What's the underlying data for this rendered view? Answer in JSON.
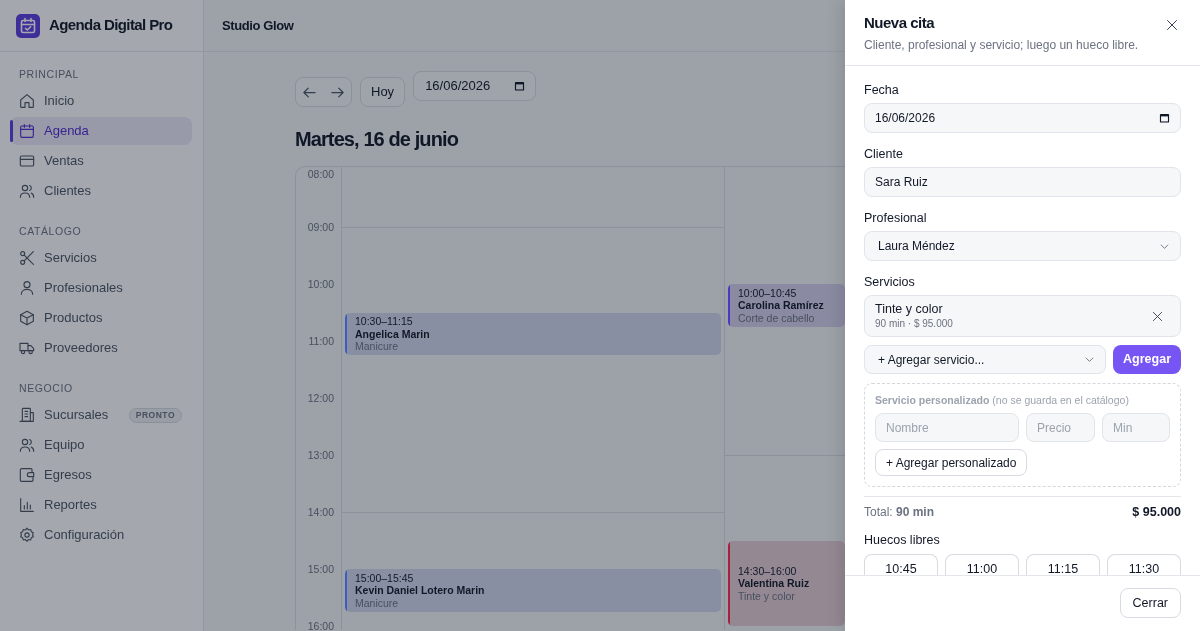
{
  "sidebar": {
    "brand": "Agenda Digital Pro",
    "sections": [
      {
        "heading": "PRINCIPAL",
        "items": [
          {
            "label": "Inicio",
            "selected": false
          },
          {
            "label": "Agenda",
            "selected": true
          },
          {
            "label": "Ventas",
            "selected": false
          },
          {
            "label": "Clientes",
            "selected": false
          }
        ]
      },
      {
        "heading": "CATÁLOGO",
        "items": [
          {
            "label": "Servicios",
            "selected": false
          },
          {
            "label": "Profesionales",
            "selected": false
          },
          {
            "label": "Productos",
            "selected": false
          },
          {
            "label": "Proveedores",
            "selected": false
          }
        ]
      },
      {
        "heading": "NEGOCIO",
        "items": [
          {
            "label": "Sucursales",
            "selected": false,
            "badge": "PRONTO"
          },
          {
            "label": "Equipo",
            "selected": false
          },
          {
            "label": "Egresos",
            "selected": false
          },
          {
            "label": "Reportes",
            "selected": false
          },
          {
            "label": "Configuración",
            "selected": false
          }
        ]
      }
    ]
  },
  "topbar": {
    "title": "Studio Glow"
  },
  "toolbar": {
    "today_button": "Hoy",
    "date": "16/06/2026"
  },
  "day_title": "Martes, 16 de junio",
  "calendar": {
    "hours": [
      "08:00",
      "09:00",
      "10:00",
      "11:00",
      "12:00",
      "13:00",
      "14:00",
      "15:00",
      "16:00"
    ],
    "columns": [
      {
        "appointments": [
          {
            "time": "10:30–11:15",
            "client": "Angelica Marin",
            "service": "Manicure",
            "color": "#3c5cc4"
          },
          {
            "time": "15:00–15:45",
            "client": "Kevin Daniel Lotero Marin",
            "service": "Manicure",
            "color": "#3c5cc4"
          }
        ]
      },
      {
        "appointments": [
          {
            "time": "10:00–10:45",
            "client": "Carolina Ramírez",
            "service": "Corte de cabello",
            "color": "#4e38c0"
          },
          {
            "time": "14:30–16:00",
            "client": "Valentina Ruiz",
            "service": "Tinte y color",
            "color": "#a8203f"
          }
        ]
      }
    ]
  },
  "panel": {
    "title": "Nueva cita",
    "subtitle": "Cliente, profesional y servicio; luego un hueco libre.",
    "fields": [
      {
        "kind": "date",
        "label": "Fecha",
        "value": "16/06/2026"
      },
      {
        "kind": "text",
        "label": "Cliente",
        "value": "Sara Ruiz"
      },
      {
        "kind": "select",
        "label": "Profesional",
        "value": "Laura Méndez"
      }
    ],
    "services": {
      "label": "Servicios",
      "items": [
        {
          "name": "Tinte y color",
          "detail": "90 min · $ 95.000"
        }
      ],
      "add_select": "+ Agregar servicio...",
      "add_button": "Agregar"
    },
    "custom_service": {
      "note": "**Servicio personalizado** (no se guarda en el catálogo)",
      "inputs": [
        {
          "placeholder": "Nombre"
        },
        {
          "placeholder": "Precio"
        },
        {
          "placeholder": "Min"
        }
      ],
      "button": "+ Agregar personalizado"
    },
    "total": {
      "duration": "Total: **90 min**",
      "price": "$ 95.000"
    },
    "slots": {
      "label": "Huecos libres",
      "items": [
        {
          "label": "10:45",
          "selected": false
        },
        {
          "label": "11:00",
          "selected": false
        },
        {
          "label": "11:15",
          "selected": false
        },
        {
          "label": "11:30",
          "selected": false
        }
      ]
    },
    "footer_button": "Cerrar"
  }
}
